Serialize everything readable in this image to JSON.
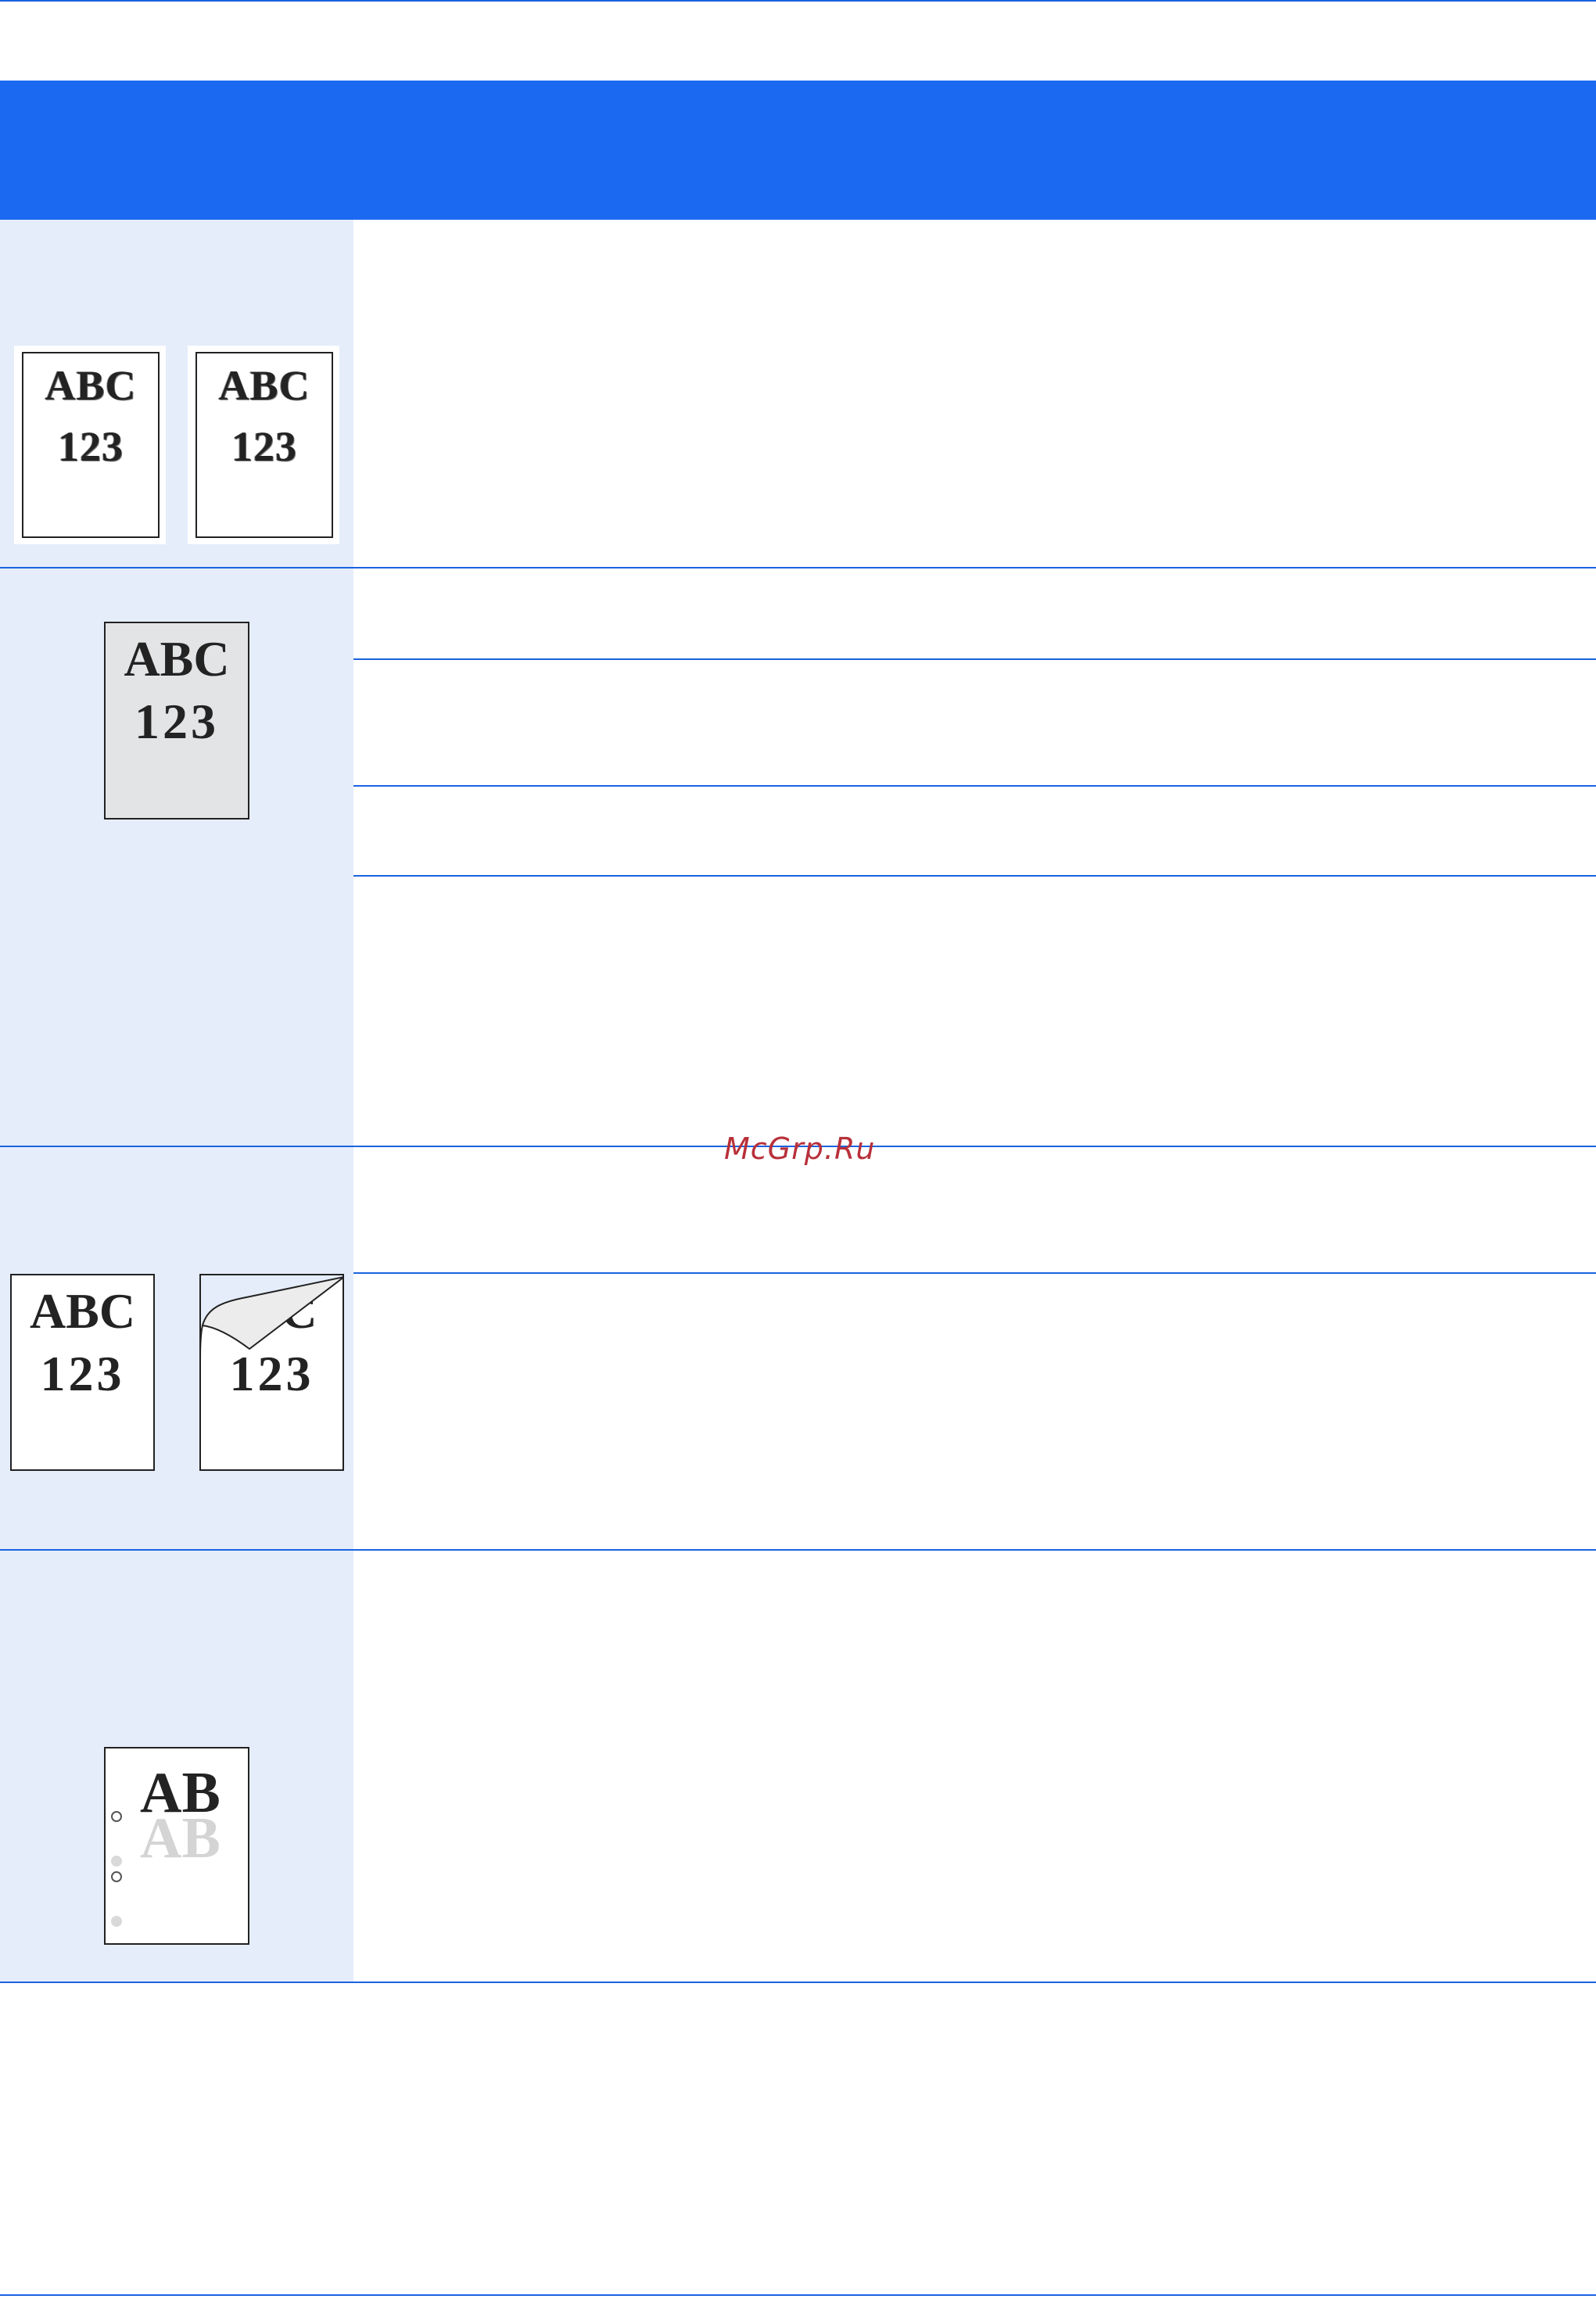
{
  "watermark": "McGrp.Ru",
  "colors": {
    "header": "#1c69f1",
    "left_column": "#e5edfb",
    "rule": "#1a63e0",
    "watermark": "#b8303a"
  },
  "row1": {
    "left_sample": {
      "line1": "ABC",
      "line2": "123"
    },
    "right_sample": {
      "line1": "ABC",
      "line2": "123"
    }
  },
  "row2": {
    "sample": {
      "line1": "ABC",
      "line2": "123"
    }
  },
  "row3": {
    "normal_sample": {
      "line1": "ABC",
      "line2": "123"
    },
    "curled_sample": {
      "line1": "C",
      "line2": "123"
    }
  },
  "row4": {
    "sample": {
      "line1": "AB",
      "ghost": "AB"
    }
  }
}
